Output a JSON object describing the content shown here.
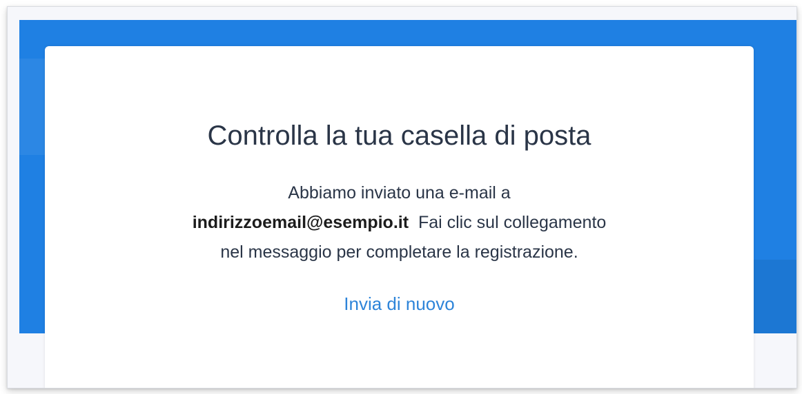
{
  "card": {
    "title": "Controlla la tua casella di posta",
    "message_line_1": "Abbiamo inviato una e-mail a",
    "email": "indirizzoemail@esempio.it",
    "message_line_2_rest": "Fai clic sul collegamento",
    "message_line_3": "nel messaggio per completare la registrazione.",
    "resend_label": "Invia di nuovo"
  },
  "colors": {
    "hero_background": "#1f80e3",
    "card_background": "#ffffff",
    "title_text": "#2a3547",
    "link": "#2d84d9"
  }
}
